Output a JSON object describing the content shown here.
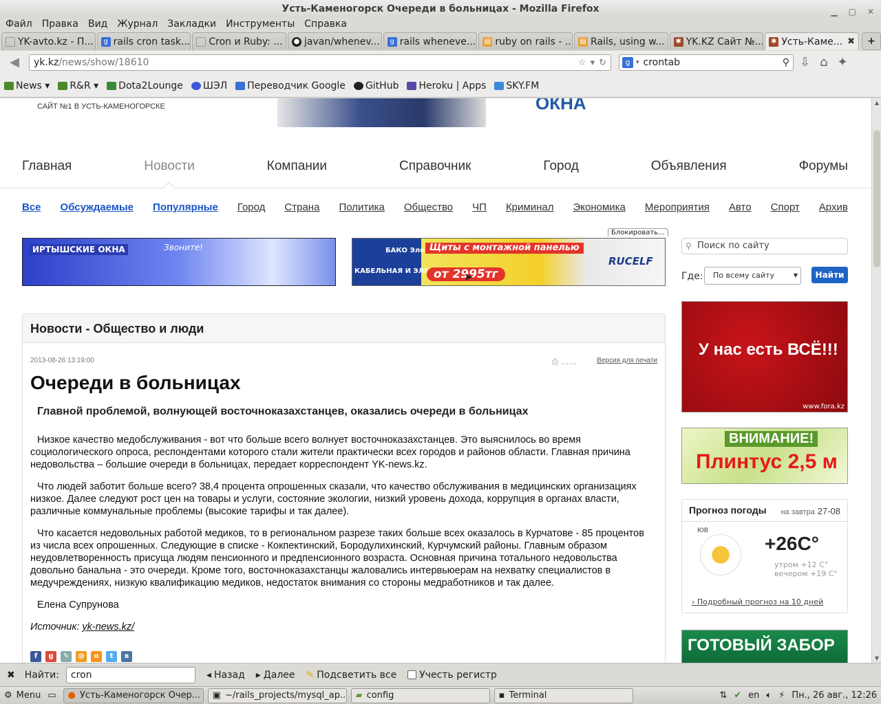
{
  "window": {
    "title": "Усть-Каменогорск Очереди в больницах - Mozilla Firefox"
  },
  "menubar": [
    "Файл",
    "Правка",
    "Вид",
    "Журнал",
    "Закладки",
    "Инструменты",
    "Справка"
  ],
  "tabs": [
    {
      "label": "YK-avto.kz - П...",
      "icon_color": "#ffffff",
      "active": false
    },
    {
      "label": "rails cron task...",
      "icon_color": "#3a6fd8",
      "active": false
    },
    {
      "label": "Cron и Ruby: ...",
      "icon_color": "#ffffff",
      "active": false
    },
    {
      "label": "javan/whenev...",
      "icon_color": "#222222",
      "active": false
    },
    {
      "label": "rails wheneve...",
      "icon_color": "#3a6fd8",
      "active": false
    },
    {
      "label": "ruby on rails - ...",
      "icon_color": "#e8a23a",
      "active": false
    },
    {
      "label": "Rails, using w...",
      "icon_color": "#e8a23a",
      "active": false
    },
    {
      "label": "YK.KZ Сайт №...",
      "icon_color": "#a04a2a",
      "active": false
    },
    {
      "label": "Усть-Каме...",
      "icon_color": "#a04a2a",
      "active": true
    }
  ],
  "url": {
    "host": "yk.kz",
    "path": "/news/show/18610"
  },
  "search": {
    "value": "crontab"
  },
  "bookmarks": [
    {
      "label": "News ▾",
      "color": "#4a8a2a"
    },
    {
      "label": "R&R ▾",
      "color": "#4a8a2a"
    },
    {
      "label": "Dota2Lounge",
      "color": "#3a8a3a"
    },
    {
      "label": "ШЭЛ",
      "color": "#3a5ad8"
    },
    {
      "label": "Переводчик Google",
      "color": "#3a6fd8"
    },
    {
      "label": "GitHub",
      "color": "#222222"
    },
    {
      "label": "Heroku | Apps",
      "color": "#5a4aa8"
    },
    {
      "label": "SKY.FM",
      "color": "#3a8ad8"
    }
  ],
  "site": {
    "tagline": "САЙТ №1 В УСТЬ-КАМЕНОГОРСКЕ",
    "header_word": "ОКНА",
    "main_nav": [
      "Главная",
      "Новости",
      "Компании",
      "Справочник",
      "Город",
      "Объявления",
      "Форумы"
    ],
    "main_nav_current": 1,
    "sub_nav": [
      "Все",
      "Обсуждаемые",
      "Популярные",
      "Город",
      "Страна",
      "Политика",
      "Общество",
      "ЧП",
      "Криминал",
      "Экономика",
      "Мероприятия",
      "Авто",
      "Спорт",
      "Архив"
    ],
    "sub_nav_highlighted": [
      0,
      1,
      2
    ]
  },
  "ads": {
    "ad1_title": "ИРТЫШСКИЕ ОКНА",
    "ad1_call": "Звоните!",
    "ad2_brand": "БАКО ЭлектроСнаб",
    "ad2_headline": "Щиты с монтажной панелью",
    "ad2_sub": "КАБЕЛЬНАЯ И ЭЛЕКТРОТЕХНИЧЕСК...",
    "ad2_price": "от 2995тг",
    "ad2_logo": "RUCELF",
    "block_label": "Блокировать...",
    "side1_text": "У нас есть ВСЁ!!!",
    "side1_url": "www.fora.kz",
    "side2_t1": "ВНИМАНИЕ!",
    "side2_t2": "Плинтус 2,5 м",
    "side3_text": "ГОТОВЫЙ ЗАБОР"
  },
  "site_search": {
    "placeholder": "Поиск по сайту",
    "where_label": "Где:",
    "where_value": "По всему сайту",
    "button": "Найти"
  },
  "weather": {
    "title": "Прогноз погоды",
    "when": "на завтра",
    "date": "27-08",
    "wind": "ЮВ",
    "temp": "+26C°",
    "morning": "утром +12 C°",
    "evening": "вечером +19 C°",
    "link": "Подробный прогноз на 10 дней"
  },
  "article": {
    "category": "Новости - Общество и люди",
    "date": "2013-08-26 13:19:00",
    "print": "Версия для печати",
    "title": "Очереди в больницах",
    "lead": "Главной проблемой, волнующей восточноказахстанцев, оказались очереди в больницах",
    "paragraphs": [
      "Низкое качество медобслуживания - вот что больше всего волнует восточноказахстанцев. Это выяснилось во время социологического опроса, респондентами которого стали жители практически всех городов и районов области. Главная причина недовольства – большие очереди в больницах, передает корреспондент YK-news.kz.",
      "Что людей заботит больше всего? 38,4 процента опрошенных сказали, что качество обслуживания в медицинских организациях низкое. Далее следуют рост цен на товары и услуги, состояние экологии, низкий уровень дохода, коррупция в органах власти, различные коммунальные проблемы (высокие тарифы и так далее).",
      "Что касается недовольных работой медиков, то в региональном разрезе таких больше всех оказалось в Курчатове - 85 процентов из числа всех опрошенных. Следующие в списке - Кокпектинский, Бородулихинский, Курчумский районы. Главным образом неудовлетворенность присуща людям пенсионного и предпенсионного возраста. Основная причина тотального недовольства довольно банальна - это очереди. Кроме того, восточноказахстанцы жаловались интервьюерам на нехватку специалистов в медучреждениях, низкую квалификацию медиков, недостаток внимания со стороны медработников и так далее.",
      "Елена Супрунова"
    ],
    "source_label": "Источник:",
    "source_link": "yk-news.kz/"
  },
  "findbar": {
    "label": "Найти:",
    "value": "cron",
    "prev": "Назад",
    "next": "Далее",
    "highlight": "Подсветить все",
    "match_case": "Учесть регистр"
  },
  "taskbar": {
    "menu": "Menu",
    "tasks": [
      {
        "label": "Усть-Каменогорск Очер...",
        "active": true
      },
      {
        "label": "~/rails_projects/mysql_ap...",
        "active": false
      },
      {
        "label": "config",
        "active": false
      },
      {
        "label": "Terminal",
        "active": false
      }
    ],
    "lang": "en",
    "clock": "Пн., 26 авг., 12:26"
  }
}
